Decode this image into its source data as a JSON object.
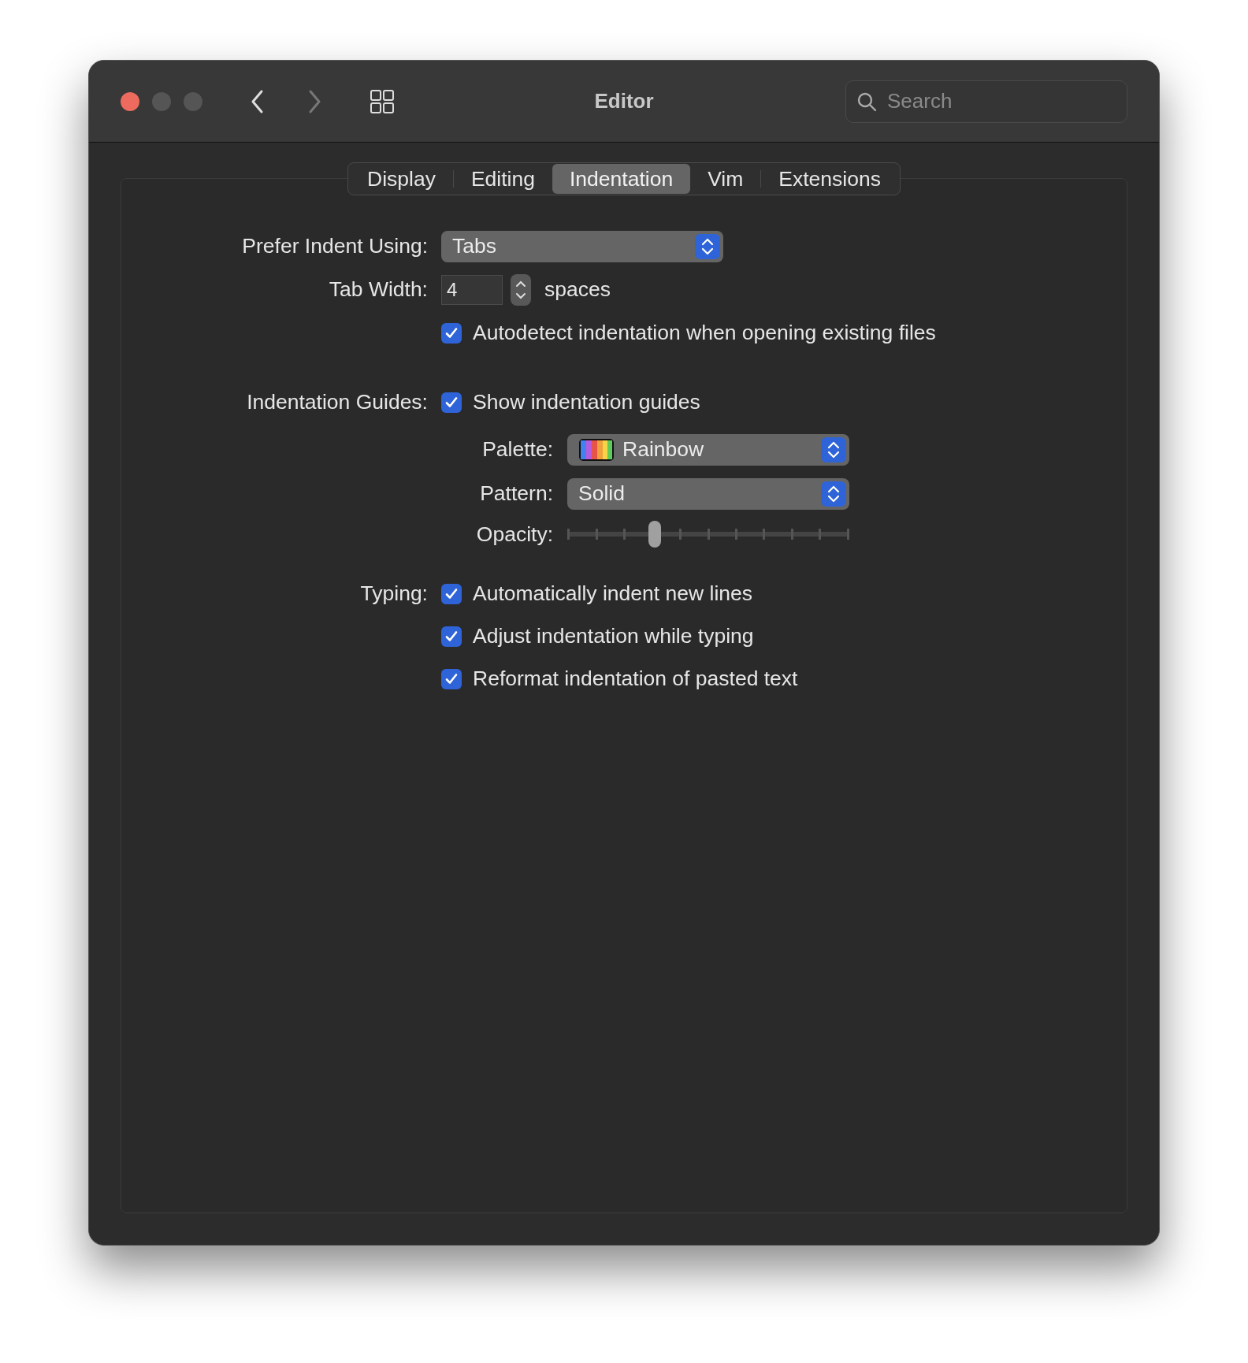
{
  "window": {
    "title": "Editor"
  },
  "toolbar": {
    "search": {
      "placeholder": "Search"
    }
  },
  "tabs": [
    {
      "label": "Display",
      "selected": false
    },
    {
      "label": "Editing",
      "selected": false
    },
    {
      "label": "Indentation",
      "selected": true
    },
    {
      "label": "Vim",
      "selected": false
    },
    {
      "label": "Extensions",
      "selected": false
    }
  ],
  "prefer_indent": {
    "label": "Prefer Indent Using:",
    "value": "Tabs"
  },
  "tab_width": {
    "label": "Tab Width:",
    "value": "4",
    "unit": "spaces"
  },
  "autodetect": {
    "label": "Autodetect indentation when opening existing files",
    "checked": true
  },
  "guides": {
    "label": "Indentation Guides:",
    "show": {
      "label": "Show indentation guides",
      "checked": true
    },
    "palette": {
      "label": "Palette:",
      "value": "Rainbow"
    },
    "pattern": {
      "label": "Pattern:",
      "value": "Solid"
    },
    "opacity": {
      "label": "Opacity:",
      "level": 0.3
    }
  },
  "typing": {
    "label": "Typing:",
    "options": [
      {
        "label": "Automatically indent new lines",
        "checked": true
      },
      {
        "label": "Adjust indentation while typing",
        "checked": true
      },
      {
        "label": "Reformat indentation of pasted text",
        "checked": true
      }
    ]
  }
}
